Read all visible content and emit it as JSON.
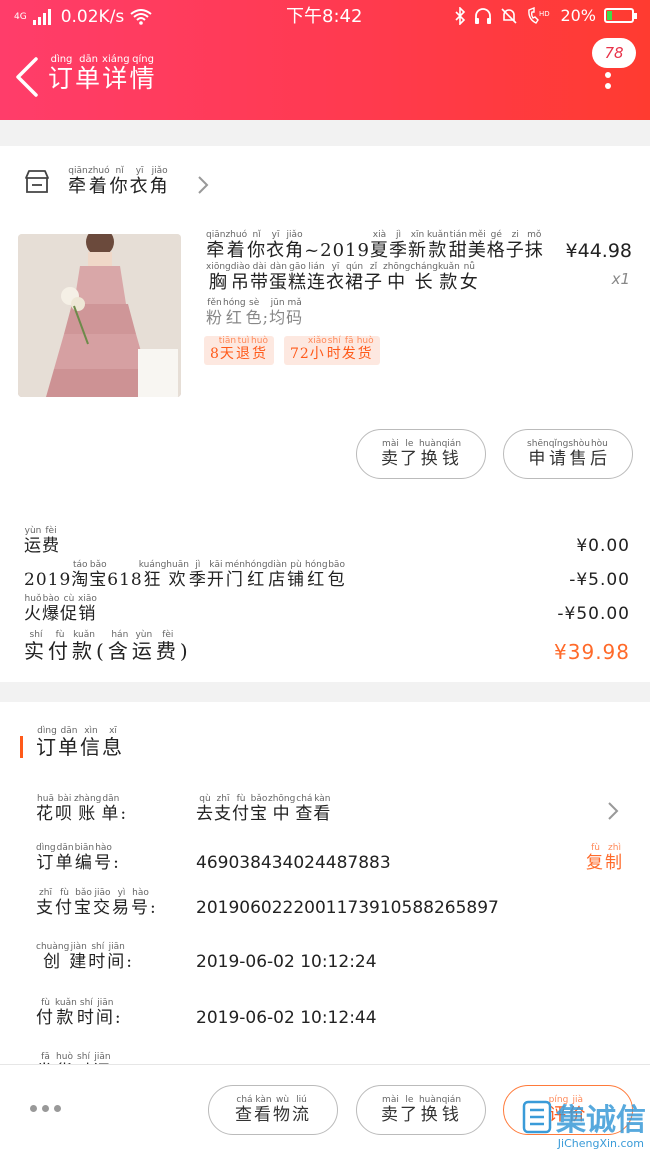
{
  "status_bar": {
    "network": "4G",
    "speed": "0.02K/s",
    "time": "下午8:42",
    "battery": "20%",
    "battery_level": 0.2
  },
  "nav": {
    "title": "订单详情",
    "badge_count": "78"
  },
  "shop": {
    "name": "牵着你衣角"
  },
  "product": {
    "title": "牵着你衣角~2019夏季新款甜美格子抹胸吊带蛋糕连衣裙子中长款女",
    "spec": "粉红色;均码",
    "price": "¥44.98",
    "quantity": "x1",
    "tags": [
      "8天退货",
      "72小时发货"
    ]
  },
  "actions": {
    "refund": "卖了换钱",
    "after_sale": "申请售后"
  },
  "fees": [
    {
      "label": "运费",
      "value": "¥0.00"
    },
    {
      "label": "2019淘宝618狂欢季开门红店铺红包",
      "value": "-¥5.00"
    },
    {
      "label": "火爆促销",
      "value": "-¥50.00"
    }
  ],
  "total": {
    "label": "实付款(含运费)",
    "value": "¥39.98"
  },
  "order_info": {
    "title": "订单信息",
    "rows": [
      {
        "label": "花呗账单:",
        "value": "去支付宝中查看"
      },
      {
        "label": "订单编号:",
        "value": "469038434024487883",
        "action": "复制"
      },
      {
        "label": "支付宝交易号:",
        "value": "2019060222001173910588265897"
      },
      {
        "label": "创建时间:",
        "value": "2019-06-02 10:12:24"
      },
      {
        "label": "付款时间:",
        "value": "2019-06-02 10:12:44"
      },
      {
        "label": "发货时间:",
        "value": ""
      }
    ]
  },
  "bottom_bar": {
    "logistics": "查看物流",
    "refund": "卖了换钱",
    "review": "评价"
  },
  "watermark": {
    "brand": "集诚信",
    "url": "JiChengXin.com"
  },
  "colors": {
    "header_start": "#ff3d6a",
    "header_end": "#ff3b30",
    "accent": "#ff5a1a"
  }
}
